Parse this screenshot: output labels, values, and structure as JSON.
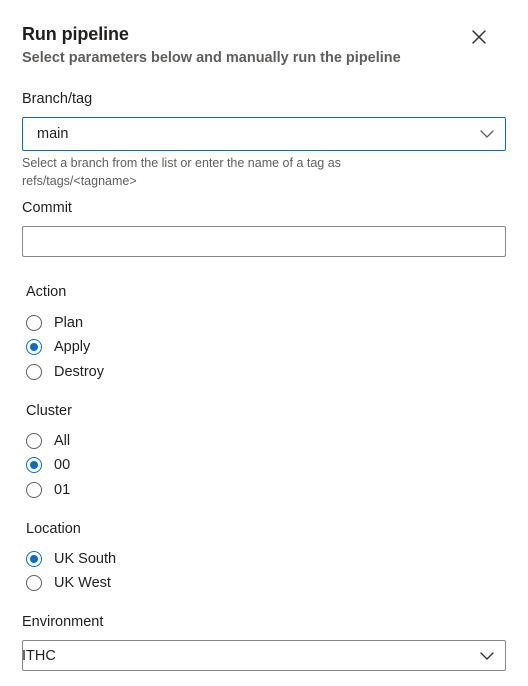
{
  "dialog": {
    "title": "Run pipeline",
    "subtitle": "Select parameters below and manually run the pipeline"
  },
  "branch": {
    "label": "Branch/tag",
    "value": "main",
    "helper": "Select a branch from the list or enter the name of a tag as refs/tags/<tagname>"
  },
  "commit": {
    "label": "Commit",
    "value": "",
    "placeholder": ""
  },
  "action": {
    "label": "Action",
    "options": [
      "Plan",
      "Apply",
      "Destroy"
    ],
    "selected": "Apply"
  },
  "cluster": {
    "label": "Cluster",
    "options": [
      "All",
      "00",
      "01"
    ],
    "selected": "00"
  },
  "location": {
    "label": "Location",
    "options": [
      "UK South",
      "UK West"
    ],
    "selected": "UK South"
  },
  "environment": {
    "label": "Environment",
    "value": "ITHC"
  },
  "colors": {
    "accent": "#0f6cbd",
    "text": "#201f1e",
    "secondary_text": "#605e5c",
    "border": "#8a8886"
  },
  "icons": {
    "close": "close-icon",
    "chevron": "chevron-down-icon"
  }
}
